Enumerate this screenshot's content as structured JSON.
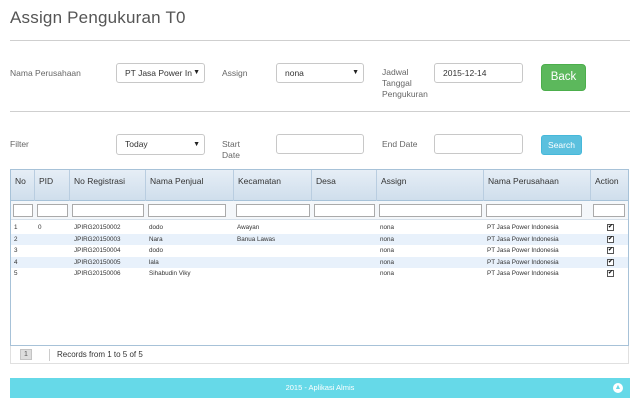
{
  "page": {
    "title": "Assign Pengukuran T0"
  },
  "form": {
    "perusahaan_label": "Nama Perusahaan",
    "perusahaan_value": "PT Jasa Power In",
    "assign_label": "Assign",
    "assign_value": "nona",
    "jadwal_label_1": "Jadwal",
    "jadwal_label_2": "Tanggal",
    "jadwal_label_3": "Pengukuran",
    "jadwal_value": "2015-12-14",
    "back_label": "Back"
  },
  "filter": {
    "filter_label": "Filter",
    "filter_value": "Today",
    "start_label_1": "Start",
    "start_label_2": "Date",
    "start_value": "",
    "end_label": "End Date",
    "end_value": "",
    "search_label": "Search"
  },
  "grid": {
    "columns": [
      "No",
      "PID",
      "No Registrasi",
      "Nama Penjual",
      "Kecamatan",
      "Desa",
      "Assign",
      "Nama Perusahaan",
      "Action"
    ],
    "rows": [
      {
        "no": "1",
        "pid": "0",
        "reg": "JPIRG20150002",
        "penjual": "dodo",
        "kecamatan": "Awayan",
        "desa": "",
        "assign": "nona",
        "perusahaan": "PT Jasa Power Indonesia",
        "checked": true
      },
      {
        "no": "2",
        "pid": "",
        "reg": "JPIRG20150003",
        "penjual": "Nara",
        "kecamatan": "Banua Lawas",
        "desa": "",
        "assign": "nona",
        "perusahaan": "PT Jasa Power Indonesia",
        "checked": true
      },
      {
        "no": "3",
        "pid": "",
        "reg": "JPIRG20150004",
        "penjual": "dodo",
        "kecamatan": "",
        "desa": "",
        "assign": "nona",
        "perusahaan": "PT Jasa Power Indonesia",
        "checked": true
      },
      {
        "no": "4",
        "pid": "",
        "reg": "JPIRG20150005",
        "penjual": "lala",
        "kecamatan": "",
        "desa": "",
        "assign": "nona",
        "perusahaan": "PT Jasa Power Indonesia",
        "checked": true
      },
      {
        "no": "5",
        "pid": "",
        "reg": "JPIRG20150006",
        "penjual": "Sihabudin Viky",
        "kecamatan": "",
        "desa": "",
        "assign": "nona",
        "perusahaan": "PT Jasa Power Indonesia",
        "checked": true
      }
    ]
  },
  "pager": {
    "page": "1",
    "records": "Records from 1 to 5 of 5"
  },
  "footer": {
    "text": "2015 - Aplikasi Almis",
    "totop_icon": "chevron-up-icon"
  },
  "colors": {
    "back": "#5cb85c",
    "search": "#5bc0de",
    "footer": "#66d9e8",
    "row_alt": "#e8f1fb"
  }
}
